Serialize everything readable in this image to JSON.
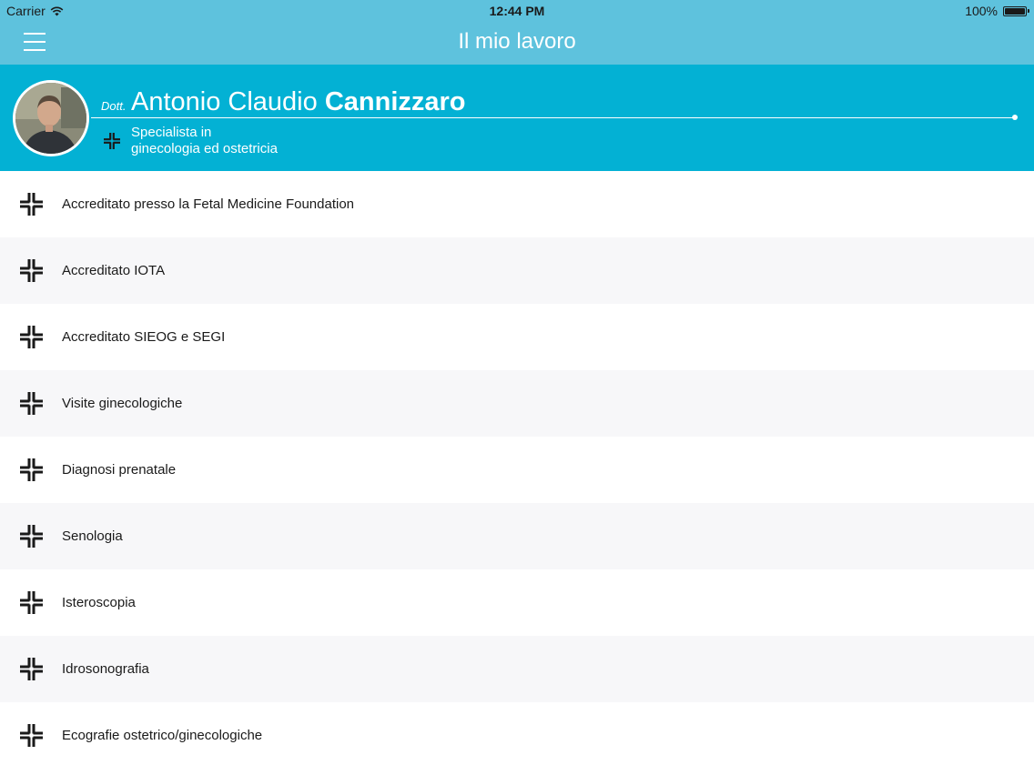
{
  "status_bar": {
    "carrier": "Carrier",
    "time": "12:44 PM",
    "battery": "100%",
    "battery_level": 1.0
  },
  "nav": {
    "title": "Il mio lavoro",
    "menu_icon": "hamburger-menu-icon"
  },
  "profile": {
    "prefix": "Dott.",
    "first_names": "Antonio Claudio",
    "last_name": "Cannizzaro",
    "specialty_line1": "Specialista in",
    "specialty_line2": "ginecologia ed ostetricia",
    "specialty_icon": "medical-cross-icon"
  },
  "services": [
    {
      "label": "Accreditato presso la Fetal Medicine Foundation",
      "icon": "medical-cross-icon"
    },
    {
      "label": "Accreditato IOTA",
      "icon": "medical-cross-icon"
    },
    {
      "label": "Accreditato SIEOG e SEGI",
      "icon": "medical-cross-icon"
    },
    {
      "label": "Visite ginecologiche",
      "icon": "medical-cross-icon"
    },
    {
      "label": "Diagnosi prenatale",
      "icon": "medical-cross-icon"
    },
    {
      "label": "Senologia",
      "icon": "medical-cross-icon"
    },
    {
      "label": "Isteroscopia",
      "icon": "medical-cross-icon"
    },
    {
      "label": "Idrosonografia",
      "icon": "medical-cross-icon"
    },
    {
      "label": "Ecografie ostetrico/ginecologiche",
      "icon": "medical-cross-icon"
    }
  ],
  "colors": {
    "nav_background": "#5ec2dd",
    "header_background": "#03b1d4",
    "row_alternate": "#f7f7f9",
    "text": "#1a1a1a"
  }
}
